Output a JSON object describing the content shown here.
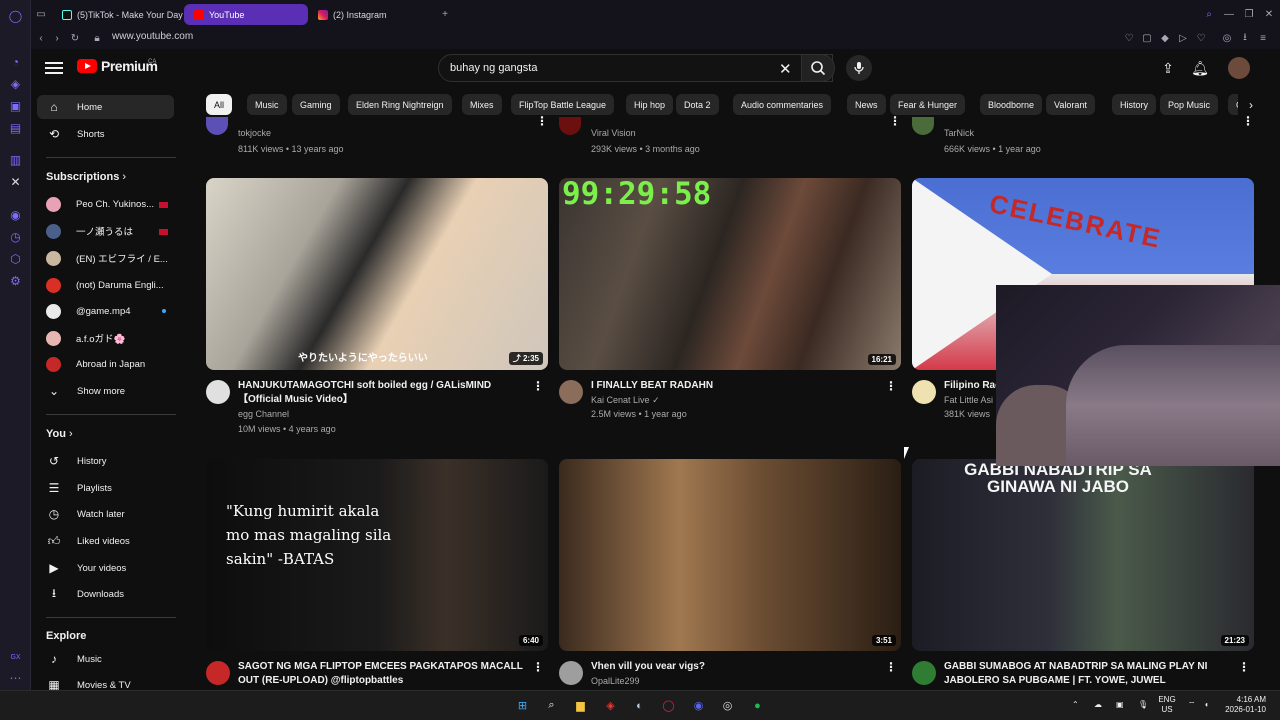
{
  "tabs": [
    {
      "label": "(5)TikTok - Make Your Day"
    },
    {
      "label": "YouTube"
    },
    {
      "label": "(2) Instagram"
    }
  ],
  "address": {
    "url": "www.youtube.com"
  },
  "header": {
    "logo_text": "Premium",
    "country": "CA",
    "search_value": "buhay ng gangsta"
  },
  "guide": {
    "main": [
      {
        "label": "Home"
      },
      {
        "label": "Shorts"
      }
    ],
    "subscriptions_heading": "Subscriptions",
    "subscriptions": [
      {
        "label": "Peo Ch. Yukinos..."
      },
      {
        "label": "一ノ瀬うるは"
      },
      {
        "label": "(EN) エビフライ / E..."
      },
      {
        "label": "(not) Daruma Engli..."
      },
      {
        "label": "@game.mp4"
      },
      {
        "label": "a.f.oガド🌸"
      },
      {
        "label": "Abroad in Japan"
      },
      {
        "label": "Show more"
      }
    ],
    "you_heading": "You",
    "you": [
      {
        "label": "History"
      },
      {
        "label": "Playlists"
      },
      {
        "label": "Watch later"
      },
      {
        "label": "Liked videos"
      },
      {
        "label": "Your videos"
      },
      {
        "label": "Downloads"
      }
    ],
    "explore_heading": "Explore",
    "explore": [
      {
        "label": "Music"
      },
      {
        "label": "Movies & TV"
      }
    ]
  },
  "chips": [
    "All",
    "Music",
    "Gaming",
    "Elden Ring Nightreign",
    "Mixes",
    "FlipTop Battle League",
    "Hip hop",
    "Dota 2",
    "Audio commentaries",
    "News",
    "Fear & Hunger",
    "Bloodborne",
    "Valorant",
    "History",
    "Pop Music",
    "C"
  ],
  "top_row": [
    {
      "channel": "tokjocke",
      "stats": "811K views • 13 years ago"
    },
    {
      "channel": "Viral Vision",
      "stats": "293K views • 3 months ago"
    },
    {
      "channel": "TarNick",
      "stats": "666K views • 1 year ago"
    }
  ],
  "videos": [
    {
      "title": "HANJUKUTAMAGOTCHI soft boiled egg / GALisMIND【Official Music Video】",
      "channel": "egg Channel",
      "stats": "10M views • 4 years ago",
      "duration": "2:35",
      "thumb_caption": "やりたいようにやったらいい"
    },
    {
      "title": "I FINALLY BEAT RADAHN",
      "channel": "Kai Cenat Live",
      "stats": "2.5M views • 1 year ago",
      "duration": "16:21",
      "thumb_caption": "99:29:58"
    },
    {
      "title": "Filipino Rac",
      "channel": "Fat Little Asi",
      "stats": "381K views",
      "duration": "",
      "thumb_caption": "CELEBRATE"
    },
    {
      "title": "SAGOT NG MGA FLIPTOP EMCEES PAGKATAPOS MACALL OUT (RE-UPLOAD) @fliptopbattles",
      "channel": "",
      "stats": "",
      "duration": "6:40",
      "thumb_caption": "\"Kung humirit akala mo mas magaling sila sakin\" -BATAS"
    },
    {
      "title": "Vhen vill you vear vigs?",
      "channel": "OpalLite299",
      "stats": "",
      "duration": "3:51",
      "thumb_caption": ""
    },
    {
      "title": "GABBI SUMABOG AT NABADTRIP SA MALING PLAY NI JABOLERO SA PUBGAME | FT. YOWE, JUWEL",
      "channel": "",
      "stats": "",
      "duration": "21:23",
      "thumb_caption": "GABBI NABADTRIP SA GINAWA NI JABO"
    }
  ],
  "taskbar": {
    "lang": "ENG",
    "region": "US",
    "time": "4:16 AM",
    "date": "2026-01-10"
  },
  "colors": {
    "accent": "#5a2fb5",
    "yt_red": "#ff0000",
    "bg": "#0f0f0f"
  }
}
